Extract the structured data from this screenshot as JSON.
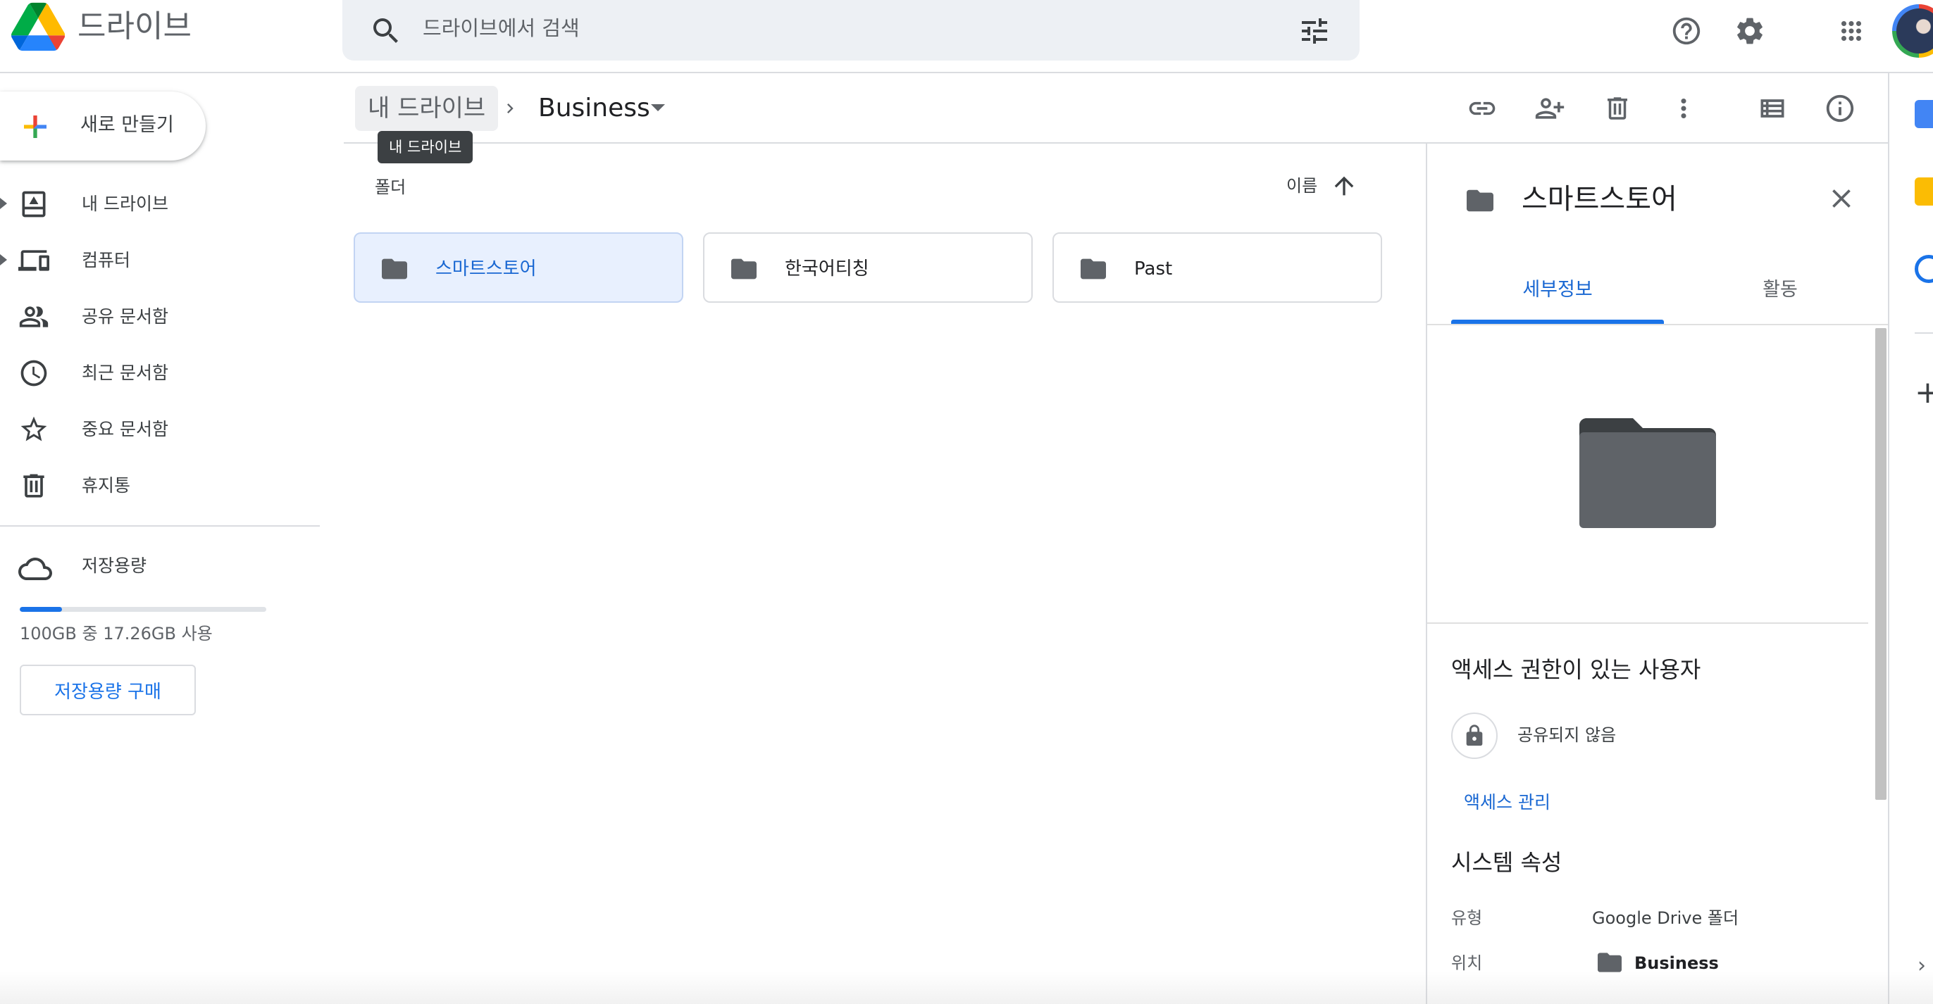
{
  "app": {
    "title": "드라이브"
  },
  "search": {
    "placeholder": "드라이브에서 검색"
  },
  "header_icons": [
    "help-icon",
    "settings-icon",
    "apps-grid-icon"
  ],
  "sidebar": {
    "new_button": "새로 만들기",
    "items": [
      {
        "label": "내 드라이브",
        "icon": "my-drive-icon",
        "expandable": true
      },
      {
        "label": "컴퓨터",
        "icon": "computers-icon",
        "expandable": true
      },
      {
        "label": "공유 문서함",
        "icon": "shared-icon",
        "expandable": false
      },
      {
        "label": "최근 문서함",
        "icon": "recent-icon",
        "expandable": false
      },
      {
        "label": "중요 문서함",
        "icon": "star-icon",
        "expandable": false
      },
      {
        "label": "휴지통",
        "icon": "trash-icon",
        "expandable": false
      }
    ],
    "storage": {
      "label": "저장용량",
      "usage_text": "100GB 중 17.26GB 사용",
      "used_fraction": 0.1726,
      "buy_button": "저장용량 구매"
    }
  },
  "breadcrumb": {
    "root": "내 드라이브",
    "current": "Business",
    "tooltip": "내 드라이브"
  },
  "toolbar_icons": [
    "link-icon",
    "share-person-icon",
    "trash-icon",
    "more-vert-icon",
    "list-view-icon",
    "info-icon"
  ],
  "main": {
    "section_label": "폴더",
    "sort_label": "이름",
    "folders": [
      {
        "name": "스마트스토어",
        "selected": true
      },
      {
        "name": "한국어티칭",
        "selected": false
      },
      {
        "name": "Past",
        "selected": false
      }
    ]
  },
  "details": {
    "title": "스마트스토어",
    "tabs": [
      "세부정보",
      "활동"
    ],
    "access_heading": "액세스 권한이 있는 사용자",
    "not_shared": "공유되지 않음",
    "manage_access": "액세스 관리",
    "system_heading": "시스템 속성",
    "type_label": "유형",
    "type_value": "Google Drive 폴더",
    "location_label": "위치",
    "location_value": "Business"
  },
  "colors": {
    "accent": "#1a73e8",
    "folder": "#5f6368",
    "selected_bg": "#e8f0fe"
  }
}
